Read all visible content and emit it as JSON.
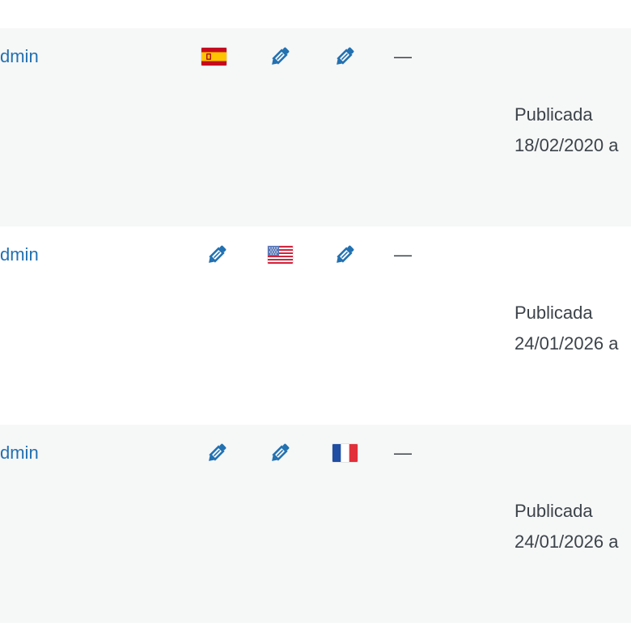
{
  "colors": {
    "link": "#2271b1",
    "text": "#3c434a",
    "row_alt": "#f6f7f7"
  },
  "rows": [
    {
      "author": "dmin",
      "lang_cells": [
        "flag-es-icon",
        "edit-pencil-icon",
        "edit-pencil-icon"
      ],
      "dash": "—",
      "status": "Publicada",
      "date": "18/02/2020 a"
    },
    {
      "author": "dmin",
      "lang_cells": [
        "edit-pencil-icon",
        "flag-us-icon",
        "edit-pencil-icon"
      ],
      "dash": "—",
      "status": "Publicada",
      "date": "24/01/2026 a"
    },
    {
      "author": "dmin",
      "lang_cells": [
        "edit-pencil-icon",
        "edit-pencil-icon",
        "flag-fr-icon"
      ],
      "dash": "—",
      "status": "Publicada",
      "date": "24/01/2026 a"
    }
  ]
}
